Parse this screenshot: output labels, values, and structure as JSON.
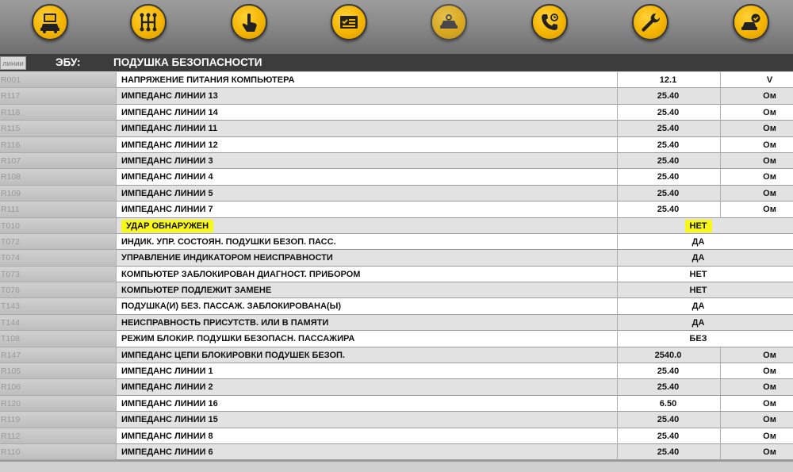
{
  "toolbar": {
    "buttons": [
      {
        "icon": "car-diagnostic-screen-icon"
      },
      {
        "icon": "gearbox-icon"
      },
      {
        "icon": "touch-hand-icon"
      },
      {
        "icon": "checklist-card-icon"
      },
      {
        "icon": "car-sensor-icon"
      },
      {
        "icon": "phone-support-icon"
      },
      {
        "icon": "wrench-icon"
      },
      {
        "icon": "car-check-icon"
      }
    ],
    "accent_color": "#f4b400"
  },
  "header": {
    "tab_label": "линии",
    "ecu_label": "ЭБУ:",
    "ecu_name": "ПОДУШКА БЕЗОПАСНОСТИ"
  },
  "rows": [
    {
      "code": "R001",
      "name": "НАПРЯЖЕНИЕ ПИТАНИЯ КОМПЬЮТЕРА",
      "value": "12.1",
      "unit": "V"
    },
    {
      "code": "R117",
      "name": "ИМПЕДАНС ЛИНИИ 13",
      "value": "25.40",
      "unit": "Ом"
    },
    {
      "code": "R118",
      "name": "ИМПЕДАНС ЛИНИИ 14",
      "value": "25.40",
      "unit": "Ом"
    },
    {
      "code": "R115",
      "name": "ИМПЕДАНС ЛИНИИ 11",
      "value": "25.40",
      "unit": "Ом"
    },
    {
      "code": "R116",
      "name": "ИМПЕДАНС ЛИНИИ 12",
      "value": "25.40",
      "unit": "Ом"
    },
    {
      "code": "R107",
      "name": "ИМПЕДАНС ЛИНИИ 3",
      "value": "25.40",
      "unit": "Ом"
    },
    {
      "code": "R108",
      "name": "ИМПЕДАНС ЛИНИИ 4",
      "value": "25.40",
      "unit": "Ом"
    },
    {
      "code": "R109",
      "name": "ИМПЕДАНС ЛИНИИ 5",
      "value": "25.40",
      "unit": "Ом"
    },
    {
      "code": "R111",
      "name": "ИМПЕДАНС ЛИНИИ 7",
      "value": "25.40",
      "unit": "Ом"
    },
    {
      "code": "T010",
      "name": "УДАР ОБНАРУЖЕН",
      "state": "НЕТ",
      "highlight": true
    },
    {
      "code": "T072",
      "name": "ИНДИК. УПР. СОСТОЯН. ПОДУШКИ БЕЗОП. ПАСС.",
      "state": "ДА"
    },
    {
      "code": "T074",
      "name": "УПРАВЛЕНИЕ ИНДИКАТОРОМ НЕИСПРАВНОСТИ",
      "state": "ДА"
    },
    {
      "code": "T073",
      "name": "КОМПЬЮТЕР ЗАБЛОКИРОВАН ДИАГНОСТ. ПРИБОРОМ",
      "state": "НЕТ"
    },
    {
      "code": "T076",
      "name": "КОМПЬЮТЕР ПОДЛЕЖИТ ЗАМЕНЕ",
      "state": "НЕТ"
    },
    {
      "code": "T143",
      "name": "ПОДУШКА(И) БЕЗ. ПАССАЖ. ЗАБЛОКИРОВАНА(Ы)",
      "state": "ДА"
    },
    {
      "code": "T144",
      "name": "НЕИСПРАВНОСТЬ ПРИСУТСТВ. ИЛИ В ПАМЯТИ",
      "state": "ДА"
    },
    {
      "code": "T108",
      "name": "РЕЖИМ БЛОКИР. ПОДУШКИ БЕЗОПАСН. ПАССАЖИРА",
      "state": "БЕЗ"
    },
    {
      "code": "R147",
      "name": "ИМПЕДАНС ЦЕПИ БЛОКИРОВКИ ПОДУШЕК БЕЗОП.",
      "value": "2540.0",
      "unit": "Ом"
    },
    {
      "code": "R105",
      "name": "ИМПЕДАНС ЛИНИИ 1",
      "value": "25.40",
      "unit": "Ом"
    },
    {
      "code": "R106",
      "name": "ИМПЕДАНС ЛИНИИ 2",
      "value": "25.40",
      "unit": "Ом"
    },
    {
      "code": "R120",
      "name": "ИМПЕДАНС ЛИНИИ 16",
      "value": "6.50",
      "unit": "Ом"
    },
    {
      "code": "R119",
      "name": "ИМПЕДАНС ЛИНИИ 15",
      "value": "25.40",
      "unit": "Ом"
    },
    {
      "code": "R112",
      "name": "ИМПЕДАНС ЛИНИИ 8",
      "value": "25.40",
      "unit": "Ом"
    },
    {
      "code": "R110",
      "name": "ИМПЕДАНС ЛИНИИ 6",
      "value": "25.40",
      "unit": "Ом"
    }
  ]
}
